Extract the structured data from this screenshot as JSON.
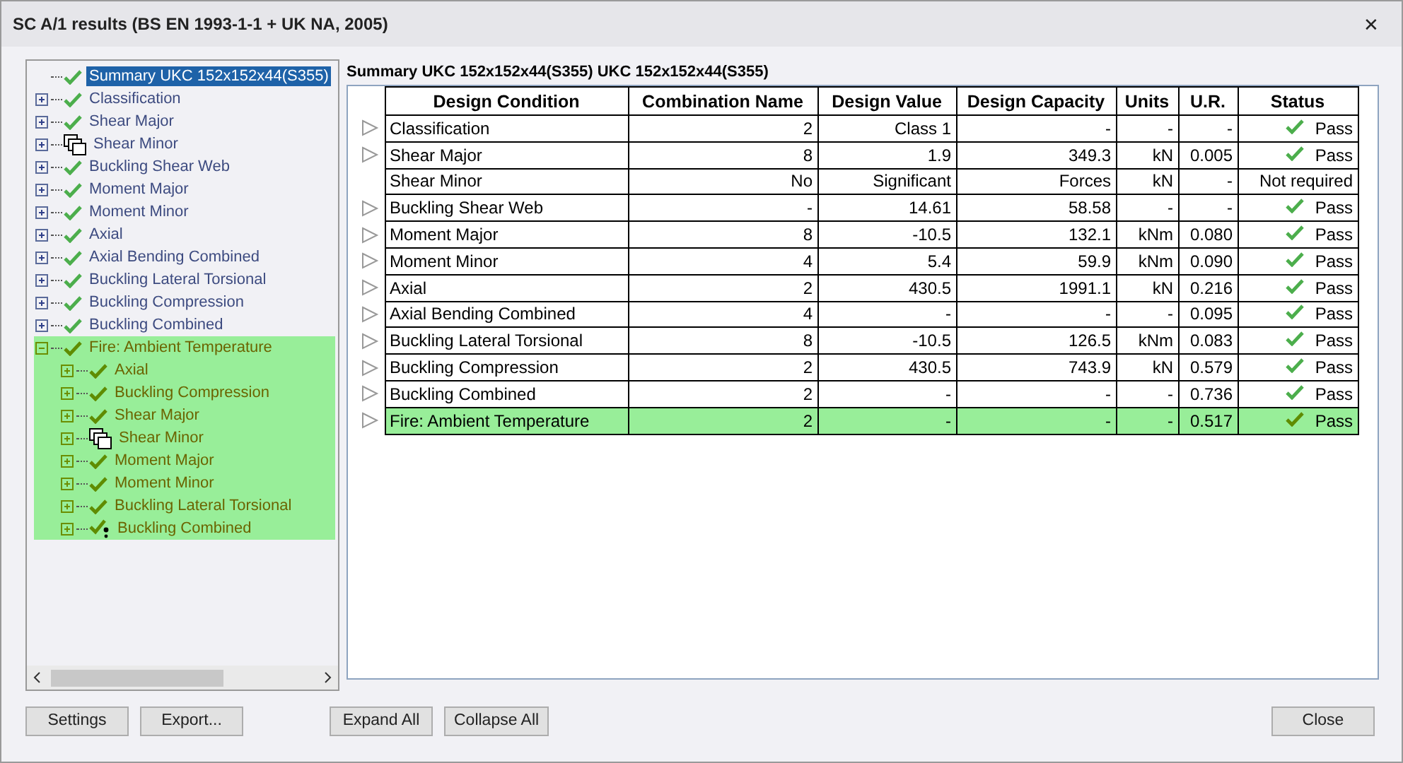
{
  "window": {
    "title": "SC A/1 results (BS EN 1993-1-1 + UK NA, 2005)",
    "close": "✕"
  },
  "tree": [
    {
      "label": "Summary UKC 152x152x44(S355)",
      "kind": "check",
      "selected": true,
      "highlighted": false
    },
    {
      "label": "Classification",
      "kind": "check",
      "selected": false,
      "highlighted": false,
      "expanded": false
    },
    {
      "label": "Shear Major",
      "kind": "check",
      "selected": false,
      "highlighted": false,
      "expanded": false
    },
    {
      "label": "Shear Minor",
      "kind": "windows",
      "selected": false,
      "highlighted": false,
      "expanded": false
    },
    {
      "label": "Buckling Shear Web",
      "kind": "check",
      "selected": false,
      "highlighted": false,
      "expanded": false
    },
    {
      "label": "Moment Major",
      "kind": "check",
      "selected": false,
      "highlighted": false,
      "expanded": false
    },
    {
      "label": "Moment Minor",
      "kind": "check",
      "selected": false,
      "highlighted": false,
      "expanded": false
    },
    {
      "label": "Axial",
      "kind": "check",
      "selected": false,
      "highlighted": false,
      "expanded": false
    },
    {
      "label": "Axial Bending Combined",
      "kind": "check",
      "selected": false,
      "highlighted": false,
      "expanded": false
    },
    {
      "label": "Buckling Lateral Torsional",
      "kind": "check",
      "selected": false,
      "highlighted": false,
      "expanded": false
    },
    {
      "label": "Buckling Compression",
      "kind": "check",
      "selected": false,
      "highlighted": false,
      "expanded": false
    },
    {
      "label": "Buckling Combined",
      "kind": "check",
      "selected": false,
      "highlighted": false,
      "expanded": false
    },
    {
      "label": "Fire: Ambient Temperature",
      "kind": "check",
      "selected": false,
      "highlighted": true,
      "expanded": true,
      "children": [
        {
          "label": "Axial",
          "kind": "check",
          "selected": false,
          "highlighted": true,
          "expanded": false
        },
        {
          "label": "Buckling Compression",
          "kind": "check",
          "selected": false,
          "highlighted": true,
          "expanded": false
        },
        {
          "label": "Shear Major",
          "kind": "check",
          "selected": false,
          "highlighted": true,
          "expanded": false
        },
        {
          "label": "Shear Minor",
          "kind": "windows",
          "selected": false,
          "highlighted": true,
          "expanded": false
        },
        {
          "label": "Moment Major",
          "kind": "check",
          "selected": false,
          "highlighted": true,
          "expanded": false
        },
        {
          "label": "Moment Minor",
          "kind": "check",
          "selected": false,
          "highlighted": true,
          "expanded": false
        },
        {
          "label": "Buckling Lateral Torsional",
          "kind": "check",
          "selected": false,
          "highlighted": true,
          "expanded": false
        },
        {
          "label": "Buckling Combined",
          "kind": "warning",
          "selected": false,
          "highlighted": true,
          "expanded": false
        }
      ]
    }
  ],
  "summary_title": "Summary UKC 152x152x44(S355) UKC 152x152x44(S355)",
  "table": {
    "columns": [
      "Design Condition",
      "Combination Name",
      "Design Value",
      "Design Capacity",
      "Units",
      "U.R.",
      "Status"
    ],
    "rows": [
      {
        "arrow": true,
        "highlighted": false,
        "passed": true,
        "cells": [
          "Classification",
          "2",
          "Class 1",
          "-",
          "-",
          "-",
          "Pass"
        ]
      },
      {
        "arrow": true,
        "highlighted": false,
        "passed": true,
        "cells": [
          "Shear Major",
          "8",
          "1.9",
          "349.3",
          "kN",
          "0.005",
          "Pass"
        ]
      },
      {
        "arrow": false,
        "highlighted": false,
        "passed": false,
        "cells": [
          "Shear Minor",
          "No",
          "Significant",
          "Forces",
          "kN",
          "-",
          "Not required"
        ]
      },
      {
        "arrow": true,
        "highlighted": false,
        "passed": true,
        "cells": [
          "Buckling Shear Web",
          "-",
          "14.61",
          "58.58",
          "-",
          "-",
          "Pass"
        ]
      },
      {
        "arrow": true,
        "highlighted": false,
        "passed": true,
        "cells": [
          "Moment Major",
          "8",
          "-10.5",
          "132.1",
          "kNm",
          "0.080",
          "Pass"
        ]
      },
      {
        "arrow": true,
        "highlighted": false,
        "passed": true,
        "cells": [
          "Moment Minor",
          "4",
          "5.4",
          "59.9",
          "kNm",
          "0.090",
          "Pass"
        ]
      },
      {
        "arrow": true,
        "highlighted": false,
        "passed": true,
        "cells": [
          "Axial",
          "2",
          "430.5",
          "1991.1",
          "kN",
          "0.216",
          "Pass"
        ]
      },
      {
        "arrow": true,
        "highlighted": false,
        "passed": true,
        "cells": [
          "Axial Bending Combined",
          "4",
          "-",
          "-",
          "-",
          "0.095",
          "Pass"
        ]
      },
      {
        "arrow": true,
        "highlighted": false,
        "passed": true,
        "cells": [
          "Buckling Lateral Torsional",
          "8",
          "-10.5",
          "126.5",
          "kNm",
          "0.083",
          "Pass"
        ]
      },
      {
        "arrow": true,
        "highlighted": false,
        "passed": true,
        "cells": [
          "Buckling Compression",
          "2",
          "430.5",
          "743.9",
          "kN",
          "0.579",
          "Pass"
        ]
      },
      {
        "arrow": true,
        "highlighted": false,
        "passed": true,
        "cells": [
          "Buckling Combined",
          "2",
          "-",
          "-",
          "-",
          "0.736",
          "Pass"
        ]
      },
      {
        "arrow": true,
        "highlighted": true,
        "passed": true,
        "cells": [
          "Fire: Ambient Temperature",
          "2",
          "-",
          "-",
          "-",
          "0.517",
          "Pass"
        ]
      }
    ]
  },
  "buttons_left": [
    "Settings",
    "Export..."
  ],
  "buttons_middle": [
    "Expand All",
    "Collapse All"
  ],
  "buttons_right": [
    "Close"
  ]
}
